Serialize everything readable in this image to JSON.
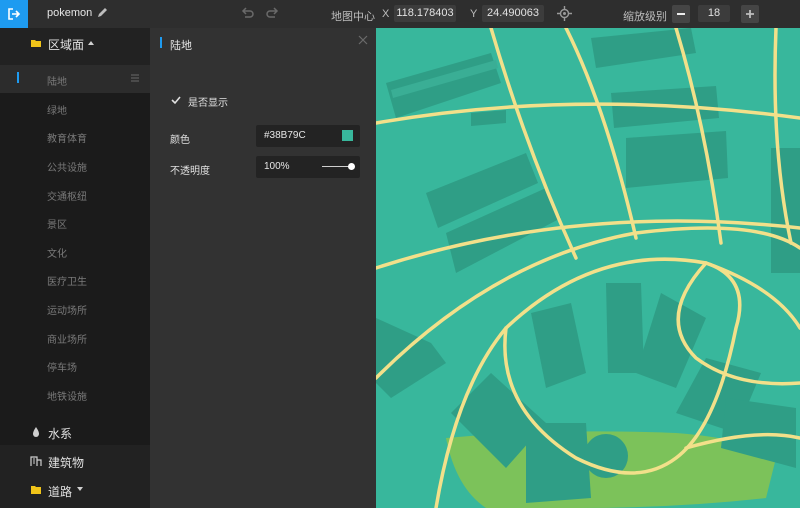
{
  "header": {
    "project_name": "pokemon",
    "center_label": "地图中心",
    "x_label": "X",
    "x_value": "118.178403",
    "y_label": "Y",
    "y_value": "24.490063",
    "zoom_label": "缩放级别",
    "zoom_value": "18"
  },
  "sidebar": {
    "categories": [
      {
        "label": "区域面",
        "icon": "folder-open-icon"
      },
      {
        "label": "水系",
        "icon": "drop-icon"
      },
      {
        "label": "建筑物",
        "icon": "building-icon"
      },
      {
        "label": "道路",
        "icon": "folder-icon"
      }
    ],
    "subitems": [
      "陆地",
      "绿地",
      "教育体育",
      "公共设施",
      "交通枢纽",
      "景区",
      "文化",
      "医疗卫生",
      "运动场所",
      "商业场所",
      "停车场",
      "地铁设施"
    ],
    "active_index": 0
  },
  "panel": {
    "title": "陆地",
    "show_label": "是否显示",
    "show_checked": true,
    "color_label": "颜色",
    "color_value": "#38B79C",
    "opacity_label": "不透明度",
    "opacity_value": "100%",
    "opacity_fraction": 1.0
  },
  "colors": {
    "accent": "#1e9bf0",
    "land": "#38B79C",
    "road": "#f2e08a",
    "park": "#7cc25a",
    "building": "#2f9e86"
  }
}
